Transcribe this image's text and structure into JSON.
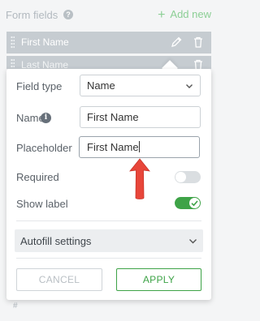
{
  "header": {
    "title": "Form fields",
    "help_icon": "question-circle-icon",
    "add_new": "Add new",
    "add_icon": "plus-icon"
  },
  "fields": [
    {
      "label": "First Name"
    },
    {
      "label": "Last Name"
    }
  ],
  "background": {
    "placeholder_hash": "#"
  },
  "popover": {
    "field_type": {
      "label": "Field type",
      "value": "Name"
    },
    "name": {
      "label": "Name",
      "value": "First Name",
      "info_icon": "info-circle-icon"
    },
    "placeholder": {
      "label": "Placeholder",
      "value": "First Name"
    },
    "required": {
      "label": "Required",
      "enabled": false
    },
    "show_label": {
      "label": "Show label",
      "enabled": true
    },
    "autofill": {
      "label": "Autofill settings"
    },
    "cancel": "CANCEL",
    "apply": "APPLY"
  },
  "colors": {
    "accent_green": "#3ea347",
    "arrow_red": "#e8463a"
  }
}
